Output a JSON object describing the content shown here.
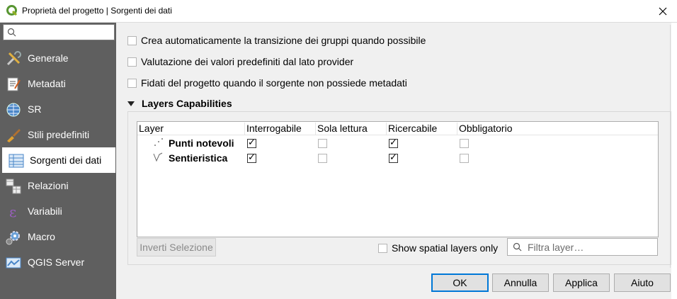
{
  "window": {
    "title": "Proprietà del progetto | Sorgenti dei dati",
    "logo_icon": "qgis-logo-icon",
    "close_icon": "close-icon"
  },
  "sidebar": {
    "search_icon": "search-icon",
    "search_value": "",
    "items": [
      {
        "label": "Generale",
        "icon": "general-tools-icon",
        "active": false
      },
      {
        "label": "Metadati",
        "icon": "metadata-icon",
        "active": false
      },
      {
        "label": "SR",
        "icon": "globe-icon",
        "active": false
      },
      {
        "label": "Stili predefiniti",
        "icon": "styles-brush-icon",
        "active": false
      },
      {
        "label": "Sorgenti dei dati",
        "icon": "data-sources-icon",
        "active": true
      },
      {
        "label": "Relazioni",
        "icon": "relations-icon",
        "active": false
      },
      {
        "label": "Variabili",
        "icon": "variables-icon",
        "active": false
      },
      {
        "label": "Macro",
        "icon": "macro-gear-icon",
        "active": false
      },
      {
        "label": "QGIS Server",
        "icon": "qgis-server-icon",
        "active": false
      }
    ]
  },
  "options": [
    {
      "label": "Crea automaticamente la transizione dei gruppi quando possibile",
      "checked": false
    },
    {
      "label": "Valutazione dei valori predefiniti dal lato provider",
      "checked": false
    },
    {
      "label": "Fidati del progetto quando il sorgente non possiede metadati",
      "checked": false
    }
  ],
  "layers_group": {
    "title": "Layers Capabilities",
    "columns": [
      "Layer",
      "Interrogabile",
      "Sola lettura",
      "Ricercabile",
      "Obbligatorio"
    ],
    "rows": [
      {
        "name": "Punti notevoli",
        "icon": "point-layer-icon",
        "interrogabile": true,
        "sola_lettura": false,
        "ricercabile": true,
        "obbligatorio": false
      },
      {
        "name": "Sentieristica",
        "icon": "line-layer-icon",
        "interrogabile": true,
        "sola_lettura": false,
        "ricercabile": true,
        "obbligatorio": false
      }
    ],
    "invert_button": "Inverti Selezione",
    "spatial_only_label": "Show spatial layers only",
    "spatial_only_checked": false,
    "filter_placeholder": "Filtra layer…",
    "filter_icon": "search-icon"
  },
  "buttons": {
    "ok": "OK",
    "cancel": "Annulla",
    "apply": "Applica",
    "help": "Aiuto"
  }
}
